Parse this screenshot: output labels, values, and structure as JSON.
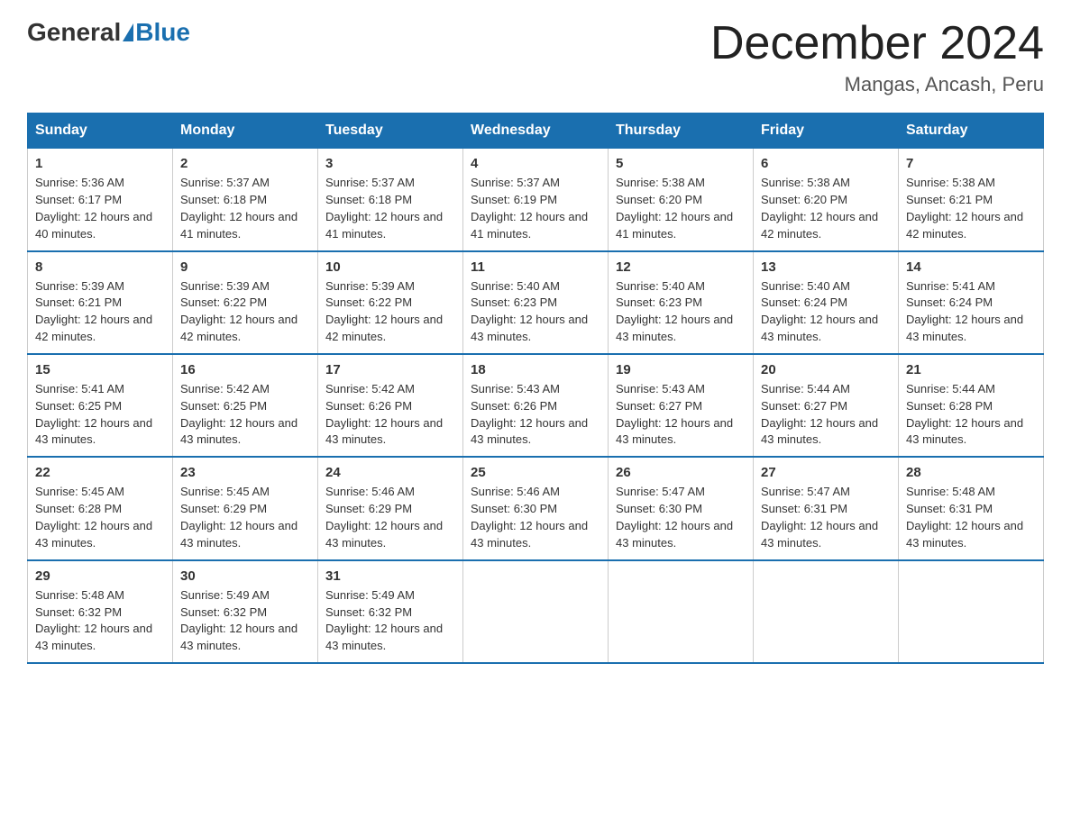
{
  "header": {
    "logo_general": "General",
    "logo_blue": "Blue",
    "month_title": "December 2024",
    "location": "Mangas, Ancash, Peru"
  },
  "weekdays": [
    "Sunday",
    "Monday",
    "Tuesday",
    "Wednesday",
    "Thursday",
    "Friday",
    "Saturday"
  ],
  "weeks": [
    [
      {
        "day": "1",
        "sunrise": "5:36 AM",
        "sunset": "6:17 PM",
        "daylight": "12 hours and 40 minutes."
      },
      {
        "day": "2",
        "sunrise": "5:37 AM",
        "sunset": "6:18 PM",
        "daylight": "12 hours and 41 minutes."
      },
      {
        "day": "3",
        "sunrise": "5:37 AM",
        "sunset": "6:18 PM",
        "daylight": "12 hours and 41 minutes."
      },
      {
        "day": "4",
        "sunrise": "5:37 AM",
        "sunset": "6:19 PM",
        "daylight": "12 hours and 41 minutes."
      },
      {
        "day": "5",
        "sunrise": "5:38 AM",
        "sunset": "6:20 PM",
        "daylight": "12 hours and 41 minutes."
      },
      {
        "day": "6",
        "sunrise": "5:38 AM",
        "sunset": "6:20 PM",
        "daylight": "12 hours and 42 minutes."
      },
      {
        "day": "7",
        "sunrise": "5:38 AM",
        "sunset": "6:21 PM",
        "daylight": "12 hours and 42 minutes."
      }
    ],
    [
      {
        "day": "8",
        "sunrise": "5:39 AM",
        "sunset": "6:21 PM",
        "daylight": "12 hours and 42 minutes."
      },
      {
        "day": "9",
        "sunrise": "5:39 AM",
        "sunset": "6:22 PM",
        "daylight": "12 hours and 42 minutes."
      },
      {
        "day": "10",
        "sunrise": "5:39 AM",
        "sunset": "6:22 PM",
        "daylight": "12 hours and 42 minutes."
      },
      {
        "day": "11",
        "sunrise": "5:40 AM",
        "sunset": "6:23 PM",
        "daylight": "12 hours and 43 minutes."
      },
      {
        "day": "12",
        "sunrise": "5:40 AM",
        "sunset": "6:23 PM",
        "daylight": "12 hours and 43 minutes."
      },
      {
        "day": "13",
        "sunrise": "5:40 AM",
        "sunset": "6:24 PM",
        "daylight": "12 hours and 43 minutes."
      },
      {
        "day": "14",
        "sunrise": "5:41 AM",
        "sunset": "6:24 PM",
        "daylight": "12 hours and 43 minutes."
      }
    ],
    [
      {
        "day": "15",
        "sunrise": "5:41 AM",
        "sunset": "6:25 PM",
        "daylight": "12 hours and 43 minutes."
      },
      {
        "day": "16",
        "sunrise": "5:42 AM",
        "sunset": "6:25 PM",
        "daylight": "12 hours and 43 minutes."
      },
      {
        "day": "17",
        "sunrise": "5:42 AM",
        "sunset": "6:26 PM",
        "daylight": "12 hours and 43 minutes."
      },
      {
        "day": "18",
        "sunrise": "5:43 AM",
        "sunset": "6:26 PM",
        "daylight": "12 hours and 43 minutes."
      },
      {
        "day": "19",
        "sunrise": "5:43 AM",
        "sunset": "6:27 PM",
        "daylight": "12 hours and 43 minutes."
      },
      {
        "day": "20",
        "sunrise": "5:44 AM",
        "sunset": "6:27 PM",
        "daylight": "12 hours and 43 minutes."
      },
      {
        "day": "21",
        "sunrise": "5:44 AM",
        "sunset": "6:28 PM",
        "daylight": "12 hours and 43 minutes."
      }
    ],
    [
      {
        "day": "22",
        "sunrise": "5:45 AM",
        "sunset": "6:28 PM",
        "daylight": "12 hours and 43 minutes."
      },
      {
        "day": "23",
        "sunrise": "5:45 AM",
        "sunset": "6:29 PM",
        "daylight": "12 hours and 43 minutes."
      },
      {
        "day": "24",
        "sunrise": "5:46 AM",
        "sunset": "6:29 PM",
        "daylight": "12 hours and 43 minutes."
      },
      {
        "day": "25",
        "sunrise": "5:46 AM",
        "sunset": "6:30 PM",
        "daylight": "12 hours and 43 minutes."
      },
      {
        "day": "26",
        "sunrise": "5:47 AM",
        "sunset": "6:30 PM",
        "daylight": "12 hours and 43 minutes."
      },
      {
        "day": "27",
        "sunrise": "5:47 AM",
        "sunset": "6:31 PM",
        "daylight": "12 hours and 43 minutes."
      },
      {
        "day": "28",
        "sunrise": "5:48 AM",
        "sunset": "6:31 PM",
        "daylight": "12 hours and 43 minutes."
      }
    ],
    [
      {
        "day": "29",
        "sunrise": "5:48 AM",
        "sunset": "6:32 PM",
        "daylight": "12 hours and 43 minutes."
      },
      {
        "day": "30",
        "sunrise": "5:49 AM",
        "sunset": "6:32 PM",
        "daylight": "12 hours and 43 minutes."
      },
      {
        "day": "31",
        "sunrise": "5:49 AM",
        "sunset": "6:32 PM",
        "daylight": "12 hours and 43 minutes."
      },
      null,
      null,
      null,
      null
    ]
  ]
}
